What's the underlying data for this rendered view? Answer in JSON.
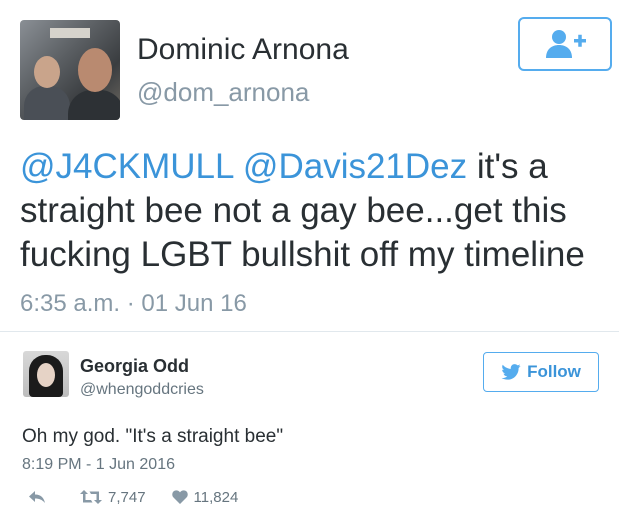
{
  "tweet": {
    "name": "Dominic Arnona",
    "handle": "@dom_arnona",
    "text_mention1": "@J4CKMULL",
    "text_mention2": "@Davis21Dez",
    "text_part1": " it's a",
    "text_line2": "straight bee not a gay bee...get this",
    "text_line3": "fucking LGBT bullshit off my timeline",
    "timestamp": "6:35 a.m. · 01 Jun 16",
    "follow_icon": "add-user-icon"
  },
  "reply": {
    "name": "Georgia Odd",
    "handle": "@whengoddcries",
    "follow_label": "Follow",
    "text": "Oh my god. \"It's a straight bee\"",
    "timestamp": "8:19 PM - 1 Jun 2016",
    "retweets": "7,747",
    "likes": "11,824"
  },
  "colors": {
    "accent": "#55acee",
    "mention": "#3b94d9",
    "muted": "#8899a6"
  }
}
